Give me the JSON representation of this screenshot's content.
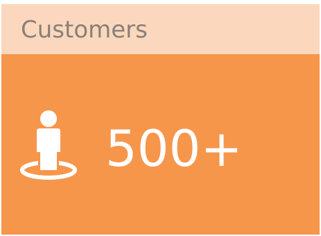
{
  "card": {
    "title": "Customers",
    "value": "500+",
    "icon": "person-standing-on-spot-icon",
    "colors": {
      "header_background": "#fbd8bd",
      "body_background": "#f6964b",
      "title_text": "#8a8079",
      "value_text": "#ffffff"
    }
  }
}
